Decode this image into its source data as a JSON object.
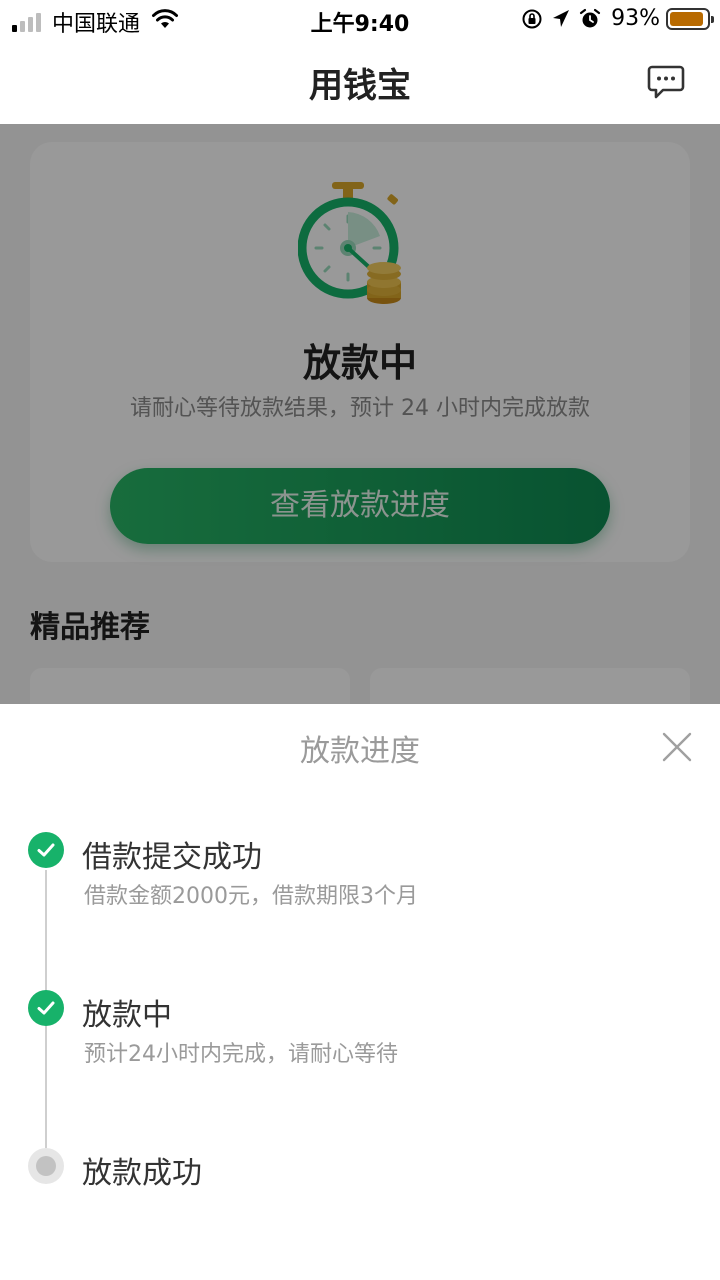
{
  "status_bar": {
    "carrier": "中国联通",
    "time": "上午9:40",
    "battery_percent": "93%",
    "battery_level": 0.93,
    "battery_color": "#b86a00"
  },
  "nav": {
    "title": "用钱宝",
    "message_icon": "chat-bubble-icon"
  },
  "loan_status": {
    "icon": "stopwatch-coins-icon",
    "title": "放款中",
    "description": "请耐心等待放款结果，预计 24 小时内完成放款",
    "button_label": "查看放款进度"
  },
  "recommendations": {
    "title": "精品推荐"
  },
  "progress_sheet": {
    "title": "放款进度",
    "close_icon": "close-icon",
    "steps": [
      {
        "title": "借款提交成功",
        "desc": "借款金额2000元，借款期限3个月",
        "state": "done"
      },
      {
        "title": "放款中",
        "desc": "预计24小时内完成，请耐心等待",
        "state": "done"
      },
      {
        "title": "放款成功",
        "desc": "",
        "state": "pending"
      }
    ]
  },
  "colors": {
    "accent_green": "#17b26a",
    "button_gradient_start": "#28b566",
    "button_gradient_end": "#0e8a52"
  }
}
